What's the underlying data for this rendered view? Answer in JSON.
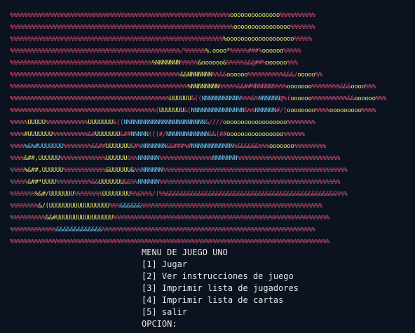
{
  "palette": {
    "background": "#0c1320",
    "P": "#e8567a",
    "Y": "#e8e36a",
    "B": "#6ec6f0",
    "G": "#88d66a",
    "W": "#e6e6e6"
  },
  "art_lines": [
    [
      [
        "P",
        "%%%%%%%%%%%%%%%%%%%%%%%%%%%%%%%%%%%%%%%%%%%%%%%%%%%%%%%%%%%%%%"
      ],
      [
        "Y",
        "oooooooooooooo"
      ],
      [
        "P",
        "%%%%%%%%%%"
      ]
    ],
    [
      [
        "P",
        "%%%%%%%%%%%%%%%%%%%%%%%%%%%%%%%%%%%%%%%%%%%%%%%%%%%%%%%%%%%%%%%"
      ],
      [
        "Y",
        "oooooooooooooooo"
      ],
      [
        "P",
        "%%%%%%%"
      ]
    ],
    [
      [
        "P",
        "%%%%%%%%%%%%%%%%%%%%%%%%%%%%%%%%%%%%%%%%%%%%%%%%%%%%%%%%%%%%"
      ],
      [
        "Y",
        "%ooooooooooooooooooo"
      ],
      [
        "P",
        "%%%%%"
      ]
    ],
    [
      [
        "P",
        "%%%%%%%%%%%%%%%%%%%%%%%%%%%%%%%%%%%%%%%%%%%%%%%%/%%%%%%"
      ],
      [
        "Y",
        "%.oooo*"
      ],
      [
        "P",
        "%%%%%###%"
      ],
      [
        "Y",
        "oooooo"
      ],
      [
        "P",
        "%%%%%"
      ]
    ],
    [
      [
        "P",
        "%%%%%%%%%%%%%%%%%%%%%%%%%%%%%%%%%%%%%%%%"
      ],
      [
        "Y",
        "%NNNNNNN"
      ],
      [
        "P",
        "%%%%%"
      ],
      [
        "Y",
        "&oooooo&"
      ],
      [
        "P",
        "%%%%%&&@##%"
      ],
      [
        "Y",
        "oooooo"
      ],
      [
        "P",
        "%%%"
      ]
    ],
    [
      [
        "P",
        "%%%%%%%%%%%%%%%%%%%%%%%%%%%%%%%%%%%%%%%%%%%%%%%%"
      ],
      [
        "Y",
        "&&NNNNNNN"
      ],
      [
        "P",
        "%%&&"
      ],
      [
        "Y",
        "oooooo"
      ],
      [
        "P",
        "%%%%%%%%%%&&&/"
      ],
      [
        "Y",
        "ooooo"
      ],
      [
        "P",
        "%%"
      ]
    ],
    [
      [
        "P",
        "%%%%%%%%%%%%%%%%%%%%%%%%%%%%%%%%%%%%%%%%%%%%%%%%%%"
      ],
      [
        "Y",
        "%NNNNNNNN"
      ],
      [
        "P",
        "%%%%%&&##NNNNNN"
      ],
      [
        "P",
        "%%%%"
      ],
      [
        "Y",
        "ooooooo"
      ],
      [
        "P",
        "%%%%%%%%&&&"
      ],
      [
        "Y",
        "oooo"
      ],
      [
        "P",
        "%%%"
      ]
    ],
    [
      [
        "P",
        "%%%%%%%%%%%%%%%%%%%%%%%%%%%%%%%%%%%%%%%%%%%%%"
      ],
      [
        "Y",
        "UUUUUU"
      ],
      [
        "P",
        "&(("
      ],
      [
        "B",
        "NNNNNNNNNNN"
      ],
      [
        "P",
        "%%%&%"
      ],
      [
        "B",
        "NNNNNN"
      ],
      [
        "P",
        "@%("
      ],
      [
        "Y",
        "oooooo"
      ],
      [
        "P",
        "%%%%%%%%%%&&"
      ],
      [
        "Y",
        "oooooo"
      ],
      [
        "P",
        "%%%"
      ]
    ],
    [
      [
        "P",
        "%%%%%%%%%%%%%%%%%%%%%%%%%%%%%%%%%%%%%%%%%("
      ],
      [
        "Y",
        "UUUUUUU"
      ],
      [
        "P",
        "&("
      ],
      [
        "B",
        "NNNNNNNNNNNNNNN"
      ],
      [
        "P",
        "&%%"
      ],
      [
        "B",
        "NNNNNN"
      ],
      [
        "P",
        "#/("
      ],
      [
        "Y",
        "oooooooo"
      ],
      [
        "P",
        "%%%%"
      ],
      [
        "Y",
        "ooooooooo"
      ],
      [
        "P",
        "%%%%"
      ]
    ],
    [
      [
        "P",
        "%%%%%"
      ],
      [
        "Y",
        "UUUUU"
      ],
      [
        "P",
        "%%%%%%%%%%%%"
      ],
      [
        "Y",
        "UUUUUUU"
      ],
      [
        "P",
        "&(("
      ],
      [
        "B",
        "NNNNNNNNNNNNNNNNNNNNNNN"
      ],
      [
        "P",
        "&////"
      ],
      [
        "Y",
        "oooooooooooooooooo"
      ],
      [
        "P",
        "%%%%%%%%"
      ]
    ],
    [
      [
        "P",
        "%%%%"
      ],
      [
        "Y",
        "#UUUUUUU"
      ],
      [
        "P",
        "%%%%%%%%%%&#"
      ],
      [
        "Y",
        "UUUUUUU"
      ],
      [
        "P",
        "&##"
      ],
      [
        "B",
        "NNNNN"
      ],
      [
        "P",
        "(((#/"
      ],
      [
        "B",
        "NNNNNNNNNNNN"
      ],
      [
        "P",
        "&&(##"
      ],
      [
        "Y",
        "oooooooooooooooo"
      ],
      [
        "P",
        "%%%%%%"
      ]
    ],
    [
      [
        "P",
        "%%%%"
      ],
      [
        "B",
        "%&%#UUUUUUU"
      ],
      [
        "P",
        "%%%%%%%%&&##"
      ],
      [
        "Y",
        "UUUUUUU"
      ],
      [
        "P",
        "&#%"
      ],
      [
        "B",
        "NNNNNNN"
      ],
      [
        "P",
        "&&###%#"
      ],
      [
        "B",
        "NNNNNNNNNNNN"
      ],
      [
        "P",
        "%&&&&&&%%%"
      ],
      [
        "Y",
        "ooooooo"
      ],
      [
        "P",
        "%%%%%%%%%"
      ]
    ],
    [
      [
        "P",
        "%%%%"
      ],
      [
        "Y",
        "&##,UUUUUU"
      ],
      [
        "P",
        "%%%%%%%%%%%%%"
      ],
      [
        "Y",
        "UUUUUU"
      ],
      [
        "P",
        "&%%"
      ],
      [
        "B",
        "NNNNNN"
      ],
      [
        "P",
        "%%%%%%%%%%%%%%%"
      ],
      [
        "B",
        "NNNNNNN"
      ],
      [
        "P",
        "%%%%%%%%%%%%%%%%%%%%%%%%%%%%%"
      ]
    ],
    [
      [
        "P",
        "%%%%"
      ],
      [
        "Y",
        "%&##,UUUUUU"
      ],
      [
        "P",
        "%%%%%%%%%%%%"
      ],
      [
        "Y",
        "&UUUUUU&"
      ],
      [
        "P",
        "%%"
      ],
      [
        "B",
        "NNNNNN"
      ],
      [
        "P",
        "%%%%%%%%%%%%%%%%%%%%%%%%%%%%%%%%%%%%%%%%%%%%%%%%%%%%"
      ]
    ],
    [
      [
        "P",
        "%%%%%"
      ],
      [
        "Y",
        "&##*UUUU"
      ],
      [
        "P",
        "%%%%%%%%%%&&"
      ],
      [
        "Y",
        "UUUUUUU"
      ],
      [
        "P",
        "&&%%"
      ],
      [
        "B",
        "NNNNNN"
      ],
      [
        "P",
        "%%%%%%%%%%%%%%%%%%%%%%%%%%%%%%%%%%%%%%%%%%%%%%%%%%%"
      ]
    ],
    [
      [
        "P",
        "%%%%%%%"
      ],
      [
        "Y",
        "%&#/UUUUUUU"
      ],
      [
        "P",
        "%%%%%%%%"
      ],
      [
        "Y",
        "UUUUUUUU"
      ],
      [
        "P",
        "%%&%%%/(%%&&&&&&&&&&&&&&&&&&&&&&&&&&&&&&&&&&&&&&&&&&&&&&&&%%%"
      ]
    ],
    [
      [
        "P",
        "%%%%%%%%"
      ],
      [
        "Y",
        "&/(UUUUUUUUUUUUUUUUU"
      ],
      [
        "P",
        "%%%"
      ],
      [
        "B",
        "&&&&&&"
      ],
      [
        "P",
        "%%%%%%%%%%%%%%%%%%%%%%%%%%%%%%%%%%%%%%%%%%%%%%%%%%%"
      ]
    ],
    [
      [
        "P",
        "%%%%%%%%%%"
      ],
      [
        "Y",
        "&&#UUUUUUUUUUUUUUUU"
      ],
      [
        "P",
        "%%%%%%%%%%%%%%%%%%%%%%%%%%%%%%%%%%%%%%%%%%%%%%%%%%%%%%%%%%%%%"
      ]
    ],
    [
      [
        "P",
        "%%%%%%%%%%%%%"
      ],
      [
        "B",
        "&&&&&&&&&&&&&"
      ],
      [
        "P",
        "%%%%%%%%%%%%%%%%%%%%%%%%%%%%%%%%%%%%%%%%%%%%%%%%%%%%%%%%%%%%"
      ]
    ],
    [
      [
        "P",
        "%%%%%%%%%%%%%%%%%%%%%%%%%%%%%%%%%%%%%%%%%%%%%%%%%%%%%%%%%%%%%%%%%%%%%%%%%%%%%%%%%%%%%%%%%%"
      ]
    ]
  ],
  "menu": {
    "title": "MENU DE JUEGO UNO",
    "options": [
      "[1] Jugar",
      "[2] Ver instrucciones de juego",
      "[3] Imprimir lista de jugadores",
      "[4] Imprimir lista de cartas",
      "[5] salir"
    ],
    "prompt": "OPCION:"
  }
}
